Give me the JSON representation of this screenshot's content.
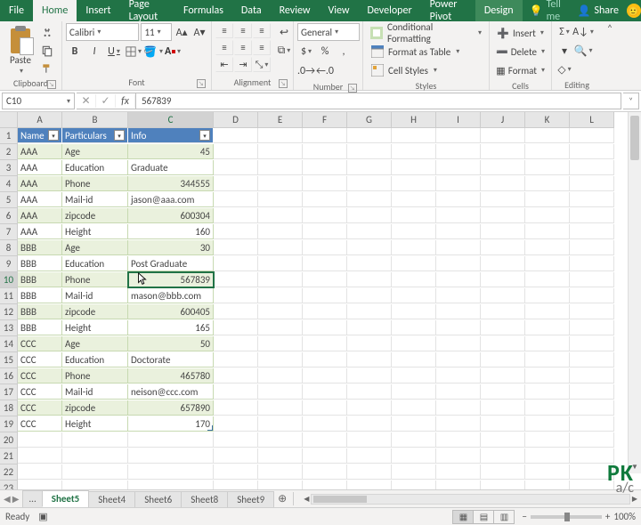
{
  "tabs": {
    "file": "File",
    "home": "Home",
    "insert": "Insert",
    "pagelayout": "Page Layout",
    "formulas": "Formulas",
    "data": "Data",
    "review": "Review",
    "view": "View",
    "developer": "Developer",
    "powerpivot": "Power Pivot",
    "design": "Design",
    "tellme": "Tell me",
    "share": "Share"
  },
  "ribbon": {
    "clipboard": {
      "paste": "Paste",
      "label": "Clipboard"
    },
    "font": {
      "name": "Calibri",
      "size": "11",
      "label": "Font"
    },
    "alignment": {
      "label": "Alignment"
    },
    "number": {
      "format": "General",
      "label": "Number"
    },
    "styles": {
      "cond": "Conditional Formatting",
      "table": "Format as Table",
      "cell": "Cell Styles",
      "label": "Styles"
    },
    "cells": {
      "insert": "Insert",
      "delete": "Delete",
      "format": "Format",
      "label": "Cells"
    },
    "editing": {
      "label": "Editing"
    }
  },
  "namebox": "C10",
  "formula": "567839",
  "col_headers": [
    "A",
    "B",
    "C",
    "D",
    "E",
    "F",
    "G",
    "H",
    "I",
    "J",
    "K",
    "L"
  ],
  "row_count": 23,
  "table": {
    "headers": [
      "Name",
      "Particulars",
      "Info"
    ],
    "rows": [
      {
        "a": "AAA",
        "b": "Age",
        "c": "45",
        "num": true
      },
      {
        "a": "AAA",
        "b": "Education",
        "c": "Graduate",
        "num": false
      },
      {
        "a": "AAA",
        "b": "Phone",
        "c": "344555",
        "num": true
      },
      {
        "a": "AAA",
        "b": "Mail-id",
        "c": "jason@aaa.com",
        "num": false
      },
      {
        "a": "AAA",
        "b": "zipcode",
        "c": "600304",
        "num": true
      },
      {
        "a": "AAA",
        "b": "Height",
        "c": "160",
        "num": true
      },
      {
        "a": "BBB",
        "b": "Age",
        "c": "30",
        "num": true
      },
      {
        "a": "BBB",
        "b": "Education",
        "c": "Post Graduate",
        "num": false
      },
      {
        "a": "BBB",
        "b": "Phone",
        "c": "567839",
        "num": true
      },
      {
        "a": "BBB",
        "b": "Mail-id",
        "c": "mason@bbb.com",
        "num": false
      },
      {
        "a": "BBB",
        "b": "zipcode",
        "c": "600405",
        "num": true
      },
      {
        "a": "BBB",
        "b": "Height",
        "c": "165",
        "num": true
      },
      {
        "a": "CCC",
        "b": "Age",
        "c": "50",
        "num": true
      },
      {
        "a": "CCC",
        "b": "Education",
        "c": "Doctorate",
        "num": false
      },
      {
        "a": "CCC",
        "b": "Phone",
        "c": "465780",
        "num": true
      },
      {
        "a": "CCC",
        "b": "Mail-id",
        "c": "neison@ccc.com",
        "num": false
      },
      {
        "a": "CCC",
        "b": "zipcode",
        "c": "657890",
        "num": true
      },
      {
        "a": "CCC",
        "b": "Height",
        "c": "170",
        "num": true
      }
    ],
    "active_row_index": 8
  },
  "sheet_tabs": {
    "list": [
      "Sheet5",
      "Sheet4",
      "Sheet6",
      "Sheet8",
      "Sheet9"
    ],
    "active": 0,
    "ellipsis": "..."
  },
  "status": {
    "ready": "Ready",
    "zoom": "100%"
  },
  "watermark": {
    "pk": "PK",
    "ac": "a/c"
  }
}
